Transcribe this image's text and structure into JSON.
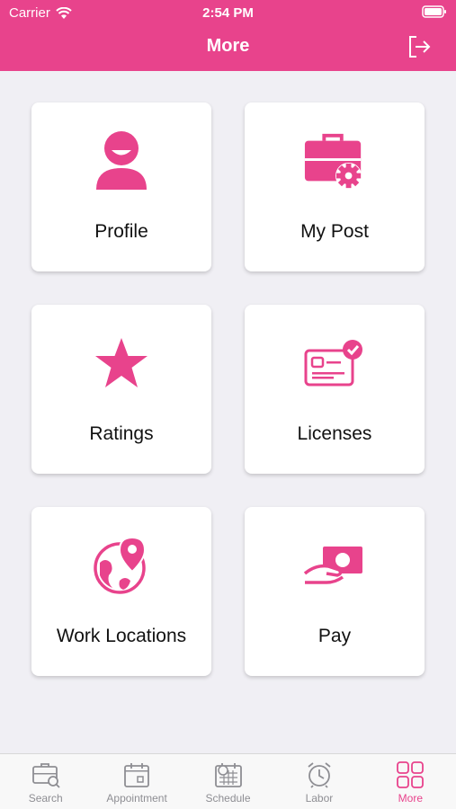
{
  "status_bar": {
    "carrier": "Carrier",
    "time": "2:54 PM"
  },
  "header": {
    "title": "More"
  },
  "accent_color": "#e8438c",
  "menu": [
    {
      "label": "Profile",
      "icon": "profile-icon"
    },
    {
      "label": "My Post",
      "icon": "briefcase-gear-icon"
    },
    {
      "label": "Ratings",
      "icon": "star-icon"
    },
    {
      "label": "Licenses",
      "icon": "license-card-icon"
    },
    {
      "label": "Work Locations",
      "icon": "globe-pin-icon"
    },
    {
      "label": "Pay",
      "icon": "hand-cash-icon"
    }
  ],
  "tabbar": [
    {
      "label": "Search",
      "icon": "briefcase-search-icon",
      "active": false
    },
    {
      "label": "Appointment",
      "icon": "calendar-icon",
      "active": false
    },
    {
      "label": "Schedule",
      "icon": "schedule-icon",
      "active": false
    },
    {
      "label": "Labor",
      "icon": "alarm-clock-icon",
      "active": false
    },
    {
      "label": "More",
      "icon": "grid-icon",
      "active": true
    }
  ]
}
